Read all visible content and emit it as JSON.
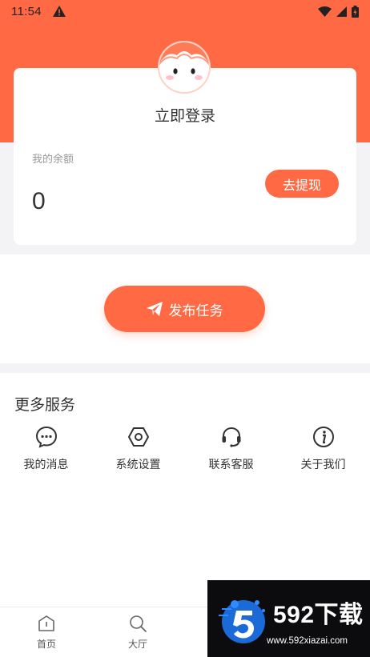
{
  "status_bar": {
    "time": "11:54"
  },
  "user_card": {
    "login_text": "立即登录",
    "balance_label": "我的余额",
    "balance_value": "0",
    "withdraw_label": "去提现"
  },
  "publish": {
    "label": "发布任务"
  },
  "services": {
    "title": "更多服务",
    "items": [
      {
        "label": "我的消息",
        "icon": "chat-bubble-icon"
      },
      {
        "label": "系统设置",
        "icon": "settings-hex-icon"
      },
      {
        "label": "联系客服",
        "icon": "headset-icon"
      },
      {
        "label": "关于我们",
        "icon": "info-icon"
      }
    ]
  },
  "bottom_nav": {
    "items": [
      {
        "label": "首页",
        "icon": "home-icon"
      },
      {
        "label": "大厅",
        "icon": "search-icon"
      }
    ]
  },
  "watermark": {
    "title": "592下载",
    "url": "www.592xiazai.com"
  },
  "colors": {
    "accent": "#ff6a45",
    "background": "#f3f3f5"
  }
}
